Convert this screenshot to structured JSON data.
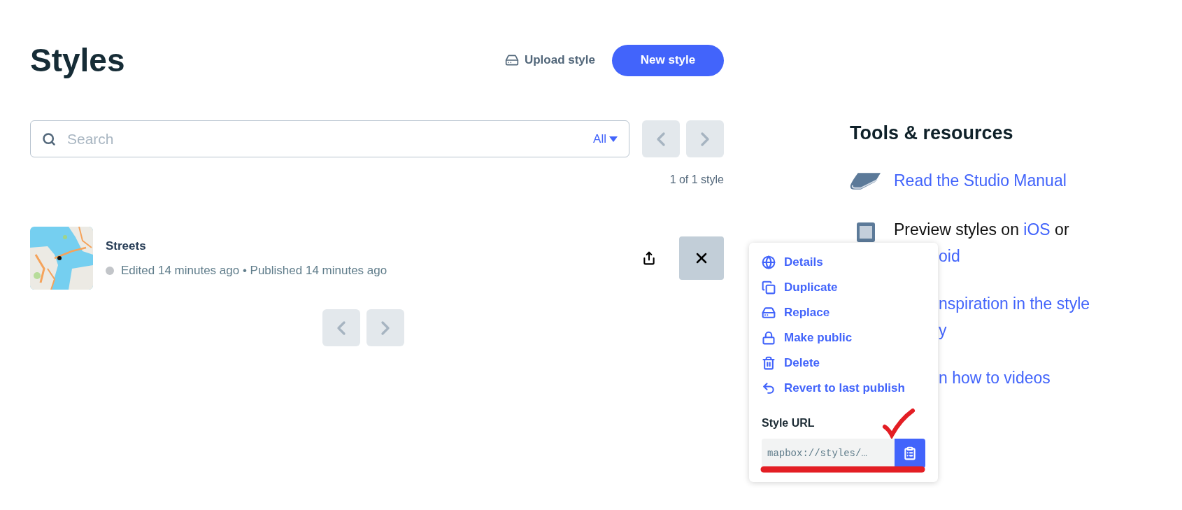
{
  "page": {
    "title": "Styles",
    "upload_button": "Upload style",
    "new_button": "New style"
  },
  "search": {
    "placeholder": "Search",
    "filter": "All",
    "count": "1 of 1 style"
  },
  "styles": [
    {
      "name": "Streets",
      "color": "#c2c5c9",
      "meta": "Edited 14 minutes ago • Published 14 minutes ago",
      "menu_open": true
    }
  ],
  "menu": {
    "items": [
      {
        "label": "Details"
      },
      {
        "label": "Duplicate"
      },
      {
        "label": "Replace"
      },
      {
        "label": "Make public"
      },
      {
        "label": "Delete"
      },
      {
        "label": "Revert to last publish"
      }
    ],
    "url_label": "Style URL",
    "url_value": "mapbox://styles/…"
  },
  "resources": {
    "title": "Tools & resources",
    "items": [
      {
        "lines": [
          {
            "parts": [
              {
                "text": "Read the Studio Manual",
                "link": true
              }
            ]
          }
        ]
      },
      {
        "lines": [
          {
            "parts": [
              {
                "text": "Preview styles on ",
                "link": false
              },
              {
                "text": "iOS",
                "link": true
              },
              {
                "text": " or",
                "link": false
              }
            ]
          },
          {
            "covered_start": true,
            "parts": [
              {
                "text": "oid",
                "link": true
              }
            ]
          }
        ]
      },
      {
        "lines": [
          {
            "covered_start": true,
            "parts": [
              {
                "text": "nspiration in the style",
                "link": true
              }
            ]
          },
          {
            "covered_start": true,
            "parts": [
              {
                "text": "y",
                "link": true
              }
            ]
          }
        ]
      },
      {
        "lines": [
          {
            "covered_start": true,
            "parts": [
              {
                "text": "n how to videos",
                "link": true
              }
            ]
          }
        ]
      }
    ]
  }
}
